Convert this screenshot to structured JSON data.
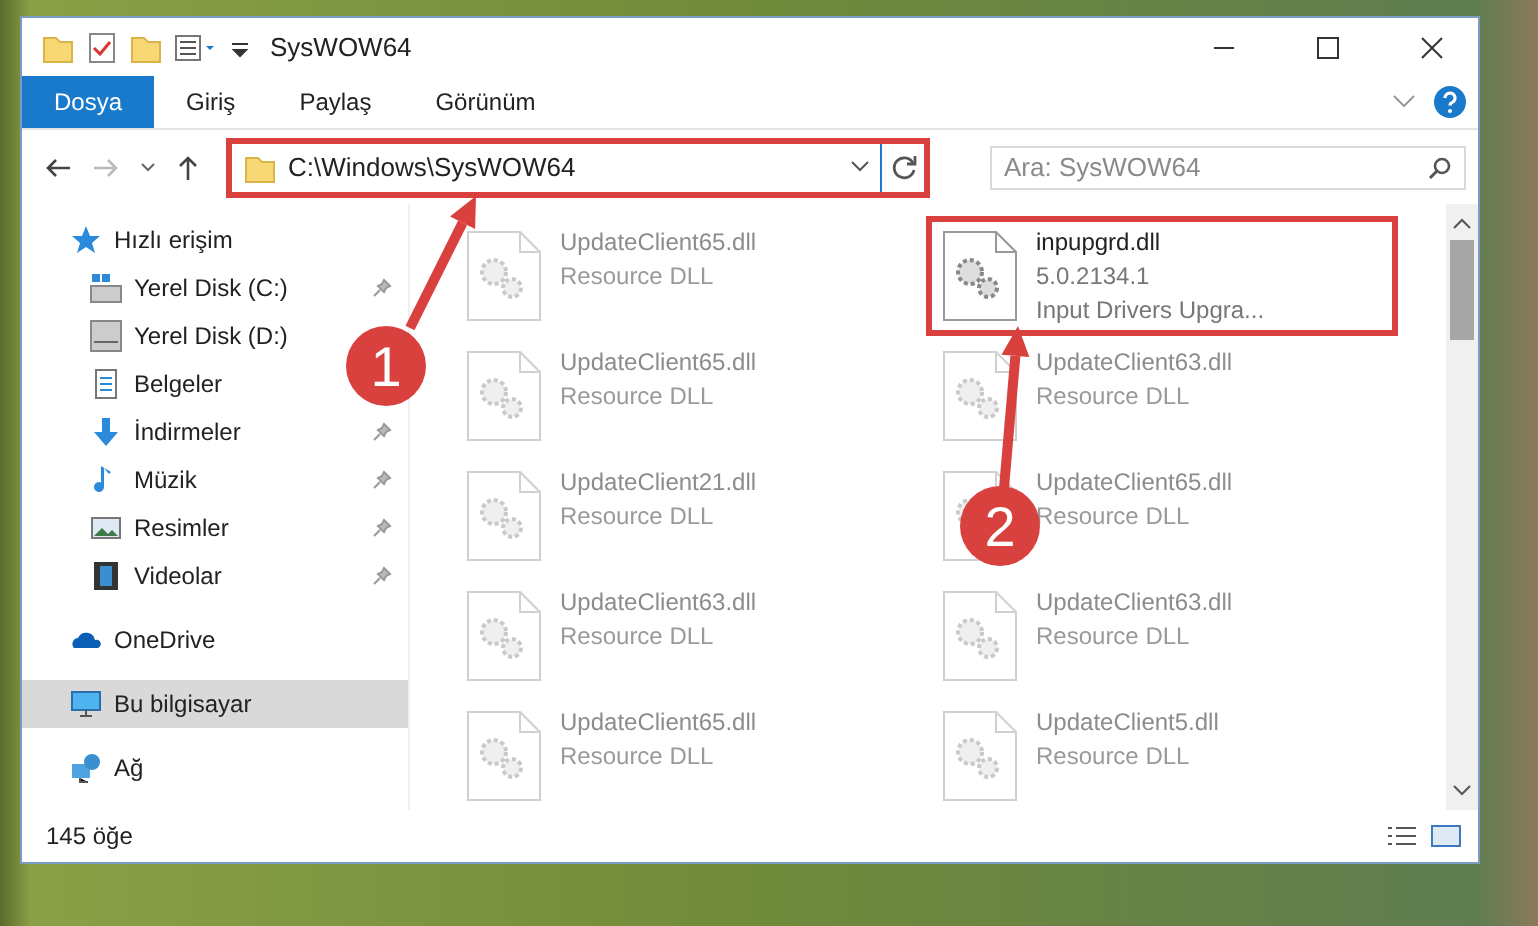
{
  "window": {
    "title": "SysWOW64"
  },
  "ribbon": {
    "tabs": [
      {
        "label": "Dosya",
        "selected": true
      },
      {
        "label": "Giriş",
        "selected": false
      },
      {
        "label": "Paylaş",
        "selected": false
      },
      {
        "label": "Görünüm",
        "selected": false
      }
    ]
  },
  "address_bar": {
    "path": "C:\\Windows\\SysWOW64",
    "highlighted": true
  },
  "search": {
    "placeholder": "Ara: SysWOW64"
  },
  "sidebar": {
    "items": [
      {
        "label": "Hızlı erişim",
        "selected": false,
        "children": [
          {
            "label": "Yerel Disk (C:)",
            "pinned": true,
            "selected": false
          },
          {
            "label": "Yerel Disk (D:)",
            "pinned": false,
            "selected": false
          },
          {
            "label": "Belgeler",
            "pinned": false,
            "selected": false
          },
          {
            "label": "İndirmeler",
            "pinned": true,
            "selected": false
          },
          {
            "label": "Müzik",
            "pinned": true,
            "selected": false
          },
          {
            "label": "Resimler",
            "pinned": true,
            "selected": false
          },
          {
            "label": "Videolar",
            "pinned": true,
            "selected": false
          }
        ]
      },
      {
        "label": "OneDrive",
        "selected": false
      },
      {
        "label": "Bu bilgisayar",
        "selected": true
      },
      {
        "label": "Ağ",
        "selected": false
      }
    ]
  },
  "files": [
    {
      "name": "UpdateClient65.dll",
      "description": "Resource DLL",
      "faded": true,
      "highlighted": false
    },
    {
      "name": "inpupgrd.dll",
      "version": "5.0.2134.1",
      "description": "Input Drivers Upgra...",
      "faded": false,
      "highlighted": true
    },
    {
      "name": "UpdateClient65.dll",
      "description": "Resource DLL",
      "faded": true,
      "highlighted": false
    },
    {
      "name": "UpdateClient63.dll",
      "description": "Resource DLL",
      "faded": true,
      "highlighted": false
    },
    {
      "name": "UpdateClient21.dll",
      "description": "Resource DLL",
      "faded": true,
      "highlighted": false
    },
    {
      "name": "UpdateClient65.dll",
      "description": "Resource DLL",
      "faded": true,
      "highlighted": false
    },
    {
      "name": "UpdateClient63.dll",
      "description": "Resource DLL",
      "faded": true,
      "highlighted": false
    },
    {
      "name": "UpdateClient63.dll",
      "description": "Resource DLL",
      "faded": true,
      "highlighted": false
    },
    {
      "name": "UpdateClient65.dll",
      "description": "Resource DLL",
      "faded": true,
      "highlighted": false
    },
    {
      "name": "UpdateClient5.dll",
      "description": "Resource DLL",
      "faded": true,
      "highlighted": false
    }
  ],
  "status_bar": {
    "item_count": "145 öğe"
  },
  "annotations": [
    {
      "number": "1"
    },
    {
      "number": "2"
    }
  ]
}
